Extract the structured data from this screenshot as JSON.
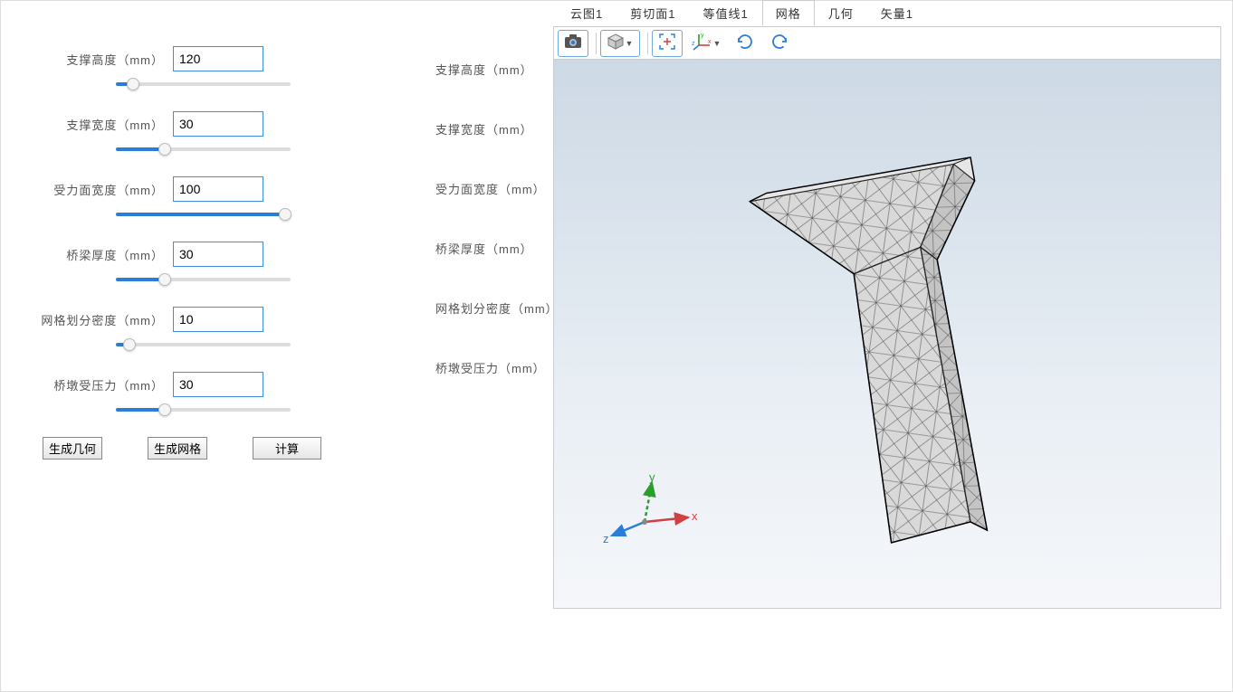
{
  "params": [
    {
      "label": "支撑高度（mm）",
      "value": "120",
      "sliderPct": 10
    },
    {
      "label": "支撑宽度（mm）",
      "value": "30",
      "sliderPct": 28
    },
    {
      "label": "受力面宽度（mm）",
      "value": "100",
      "sliderPct": 97
    },
    {
      "label": "桥梁厚度（mm）",
      "value": "30",
      "sliderPct": 28
    },
    {
      "label": "网格划分密度（mm）",
      "value": "10",
      "sliderPct": 8
    },
    {
      "label": "桥墩受压力（mm）",
      "value": "30",
      "sliderPct": 28
    }
  ],
  "rightLabels": [
    "支撑高度（mm）",
    "支撑宽度（mm）",
    "受力面宽度（mm）",
    "桥梁厚度（mm）",
    "网格划分密度（mm）",
    "桥墩受压力（mm）"
  ],
  "buttons": {
    "geom": "生成几何",
    "mesh": "生成网格",
    "calc": "计算"
  },
  "tabs": [
    {
      "label": "云图1",
      "active": false
    },
    {
      "label": "剪切面1",
      "active": false
    },
    {
      "label": "等值线1",
      "active": false
    },
    {
      "label": "网格",
      "active": true
    },
    {
      "label": "几何",
      "active": false
    },
    {
      "label": "矢量1",
      "active": false
    }
  ],
  "axisLabels": {
    "x": "x",
    "y": "y",
    "z": "z"
  }
}
